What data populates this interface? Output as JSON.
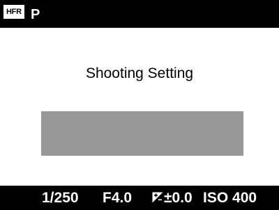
{
  "top_bar": {
    "hfr_badge": "HFR",
    "mode": "P"
  },
  "screen": {
    "title": "Shooting Setting"
  },
  "bottom_bar": {
    "shutter_speed": "1/250",
    "aperture": "F4.0",
    "exposure_comp_icon": "exposure-compensation-icon",
    "exposure_comp": "±0.0",
    "iso": "ISO 400"
  }
}
